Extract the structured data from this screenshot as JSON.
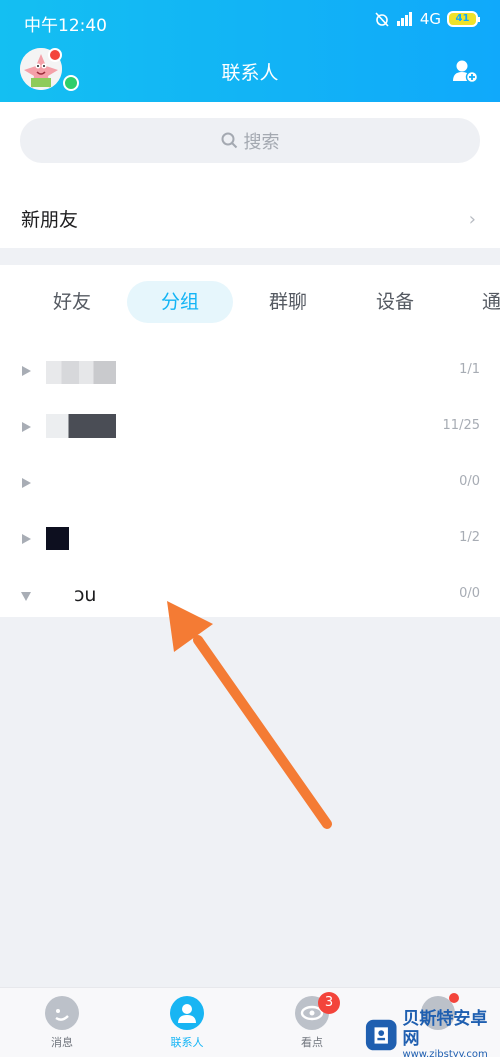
{
  "status_bar": {
    "time": "中午12:40",
    "network": "4G",
    "battery": "41"
  },
  "header": {
    "title": "联系人"
  },
  "search": {
    "placeholder": "搜索"
  },
  "new_friends": {
    "label": "新朋友"
  },
  "tabs": [
    {
      "label": "好友",
      "active": false
    },
    {
      "label": "分组",
      "active": true
    },
    {
      "label": "群聊",
      "active": false
    },
    {
      "label": "设备",
      "active": false
    },
    {
      "label": "通",
      "active": false
    }
  ],
  "groups": [
    {
      "name": "",
      "count": "1/1",
      "expanded": false
    },
    {
      "name": "",
      "count": "11/25",
      "expanded": false
    },
    {
      "name": "",
      "count": "0/0",
      "expanded": false
    },
    {
      "name": "",
      "count": "1/2",
      "expanded": false
    },
    {
      "name": "ɔu",
      "count": "0/0",
      "expanded": true
    }
  ],
  "tabbar": [
    {
      "label": "消息",
      "active": false
    },
    {
      "label": "联系人",
      "active": true
    },
    {
      "label": "看点",
      "active": false,
      "badge": "3"
    },
    {
      "label": "",
      "active": false
    }
  ],
  "watermark": {
    "title": "贝斯特安卓网",
    "url": "www.zjbstyy.com"
  },
  "colors": {
    "accent": "#12b4f5",
    "badge": "#f3443b",
    "arrow": "#f47b34"
  }
}
